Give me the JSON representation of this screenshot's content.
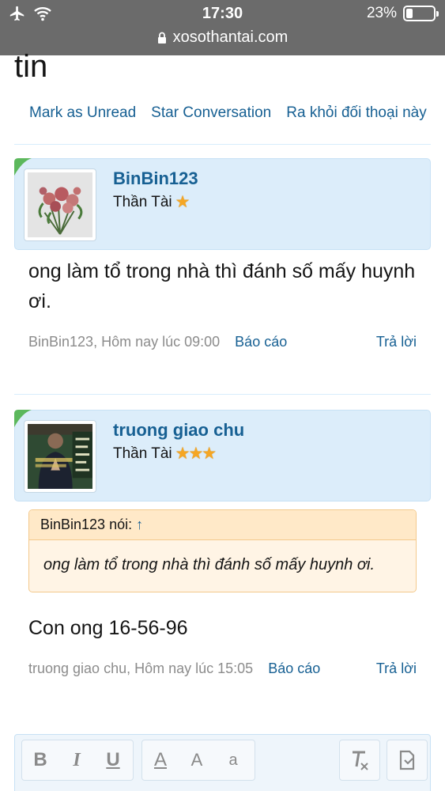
{
  "status_bar": {
    "time": "17:30",
    "battery_percent": "23%",
    "battery_level": 0.23,
    "url": "xosothantai.com",
    "icons": [
      "airplane-icon",
      "wifi-icon",
      "lock-icon"
    ]
  },
  "page": {
    "heading_partial": "tin",
    "thread_links": [
      "Mark as Unread",
      "Star Conversation",
      "Ra khỏi đối thoại này"
    ]
  },
  "messages": [
    {
      "username": "BinBin123",
      "user_title": "Thần Tài",
      "stars": "★",
      "body": "ong làm tổ trong nhà thì đánh số mấy huynh ơi.",
      "meta": "BinBin123, Hôm nay lúc 09:00",
      "report": "Báo cáo",
      "reply": "Trả lời"
    },
    {
      "username": "truong giao chu",
      "user_title": "Thần Tài",
      "stars": "★★★",
      "quote": {
        "author": "BinBin123 nói:",
        "arrow": "↑",
        "text": "ong làm tổ trong nhà thì đánh số mấy huynh ơi."
      },
      "body": "Con ong 16-56-96",
      "meta": "truong giao chu, Hôm nay lúc 15:05",
      "report": "Báo cáo",
      "reply": "Trả lời"
    }
  ],
  "editor_toolbar": {
    "buttons": [
      "B",
      "I",
      "U",
      "A",
      "A",
      "a"
    ]
  },
  "colors": {
    "link": "#176093",
    "header_bg": "#dcedfa",
    "quote_bg": "#fff4e5",
    "quote_border": "#f3c98c",
    "status_bar": "#6b6b6b",
    "star": "#f5a623"
  }
}
